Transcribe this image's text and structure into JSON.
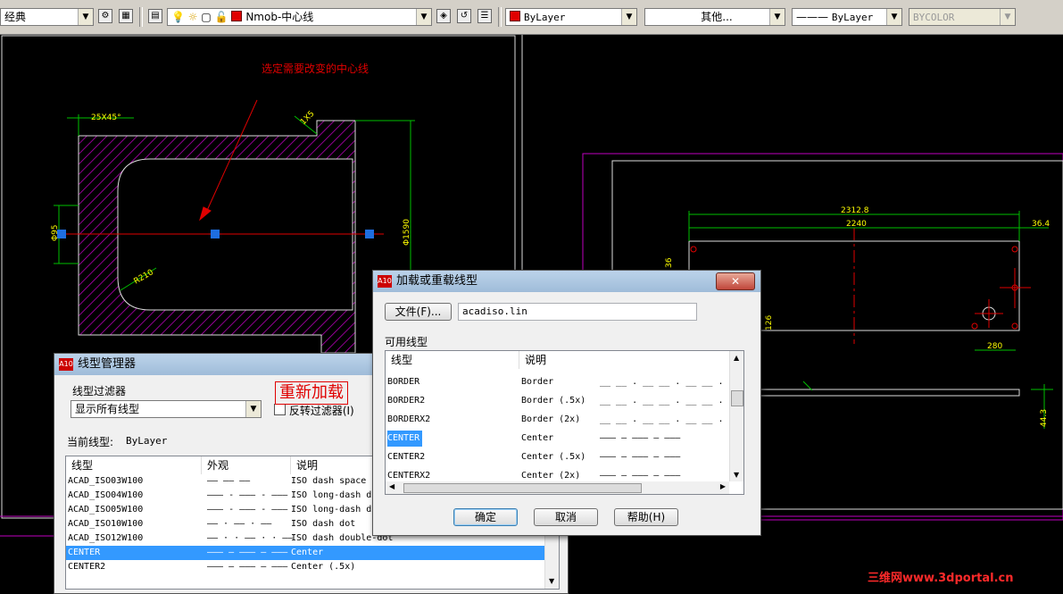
{
  "toolbar": {
    "workspace_combo": "经典",
    "layer_combo": "Nmob-中心线",
    "color_combo": "ByLayer",
    "linetype_combo": "其他...",
    "lineweight_combo": "ByLayer",
    "plotstyle_combo": "BYCOLOR"
  },
  "annotation": {
    "select_center_line": "选定需要改变的中心线",
    "reload": "重新加载"
  },
  "drawing": {
    "dims": [
      "25X45°",
      "Φ1590",
      "R210",
      "2312.8",
      "2240",
      "36.4",
      "280",
      "126",
      "44.3"
    ]
  },
  "watermark": "三维网www.3dportal.cn",
  "linetype_manager": {
    "title": "线型管理器",
    "filter_label": "线型过滤器",
    "filter_value": "显示所有线型",
    "invert_filter": "反转过滤器(I)",
    "current_label": "当前线型:",
    "current_value": "ByLayer",
    "col_linetype": "线型",
    "col_appearance": "外观",
    "col_description": "说明",
    "rows": [
      {
        "name": "ACAD_ISO03W100",
        "desc": "ISO dash space",
        "selected": false
      },
      {
        "name": "ACAD_ISO04W100",
        "desc": "ISO long-dash d",
        "selected": false
      },
      {
        "name": "ACAD_ISO05W100",
        "desc": "ISO long-dash d",
        "selected": false
      },
      {
        "name": "ACAD_ISO10W100",
        "desc": "ISO dash dot",
        "selected": false
      },
      {
        "name": "ACAD_ISO12W100",
        "desc": "ISO dash double-dot",
        "selected": false
      },
      {
        "name": "CENTER",
        "desc": "Center",
        "selected": true
      },
      {
        "name": "CENTER2",
        "desc": "Center (.5x)",
        "selected": false
      }
    ]
  },
  "load_dialog": {
    "title": "加载或重载线型",
    "file_button": "文件(F)...",
    "file_value": "acadiso.lin",
    "available_label": "可用线型",
    "col_linetype": "线型",
    "col_description": "说明",
    "rows": [
      {
        "name": "BORDER",
        "desc": "Border",
        "selected": false
      },
      {
        "name": "BORDER2",
        "desc": "Border (.5x)",
        "selected": false
      },
      {
        "name": "BORDERX2",
        "desc": "Border (2x)",
        "selected": false
      },
      {
        "name": "CENTER",
        "desc": "Center",
        "selected": true
      },
      {
        "name": "CENTER2",
        "desc": "Center (.5x)",
        "selected": false
      },
      {
        "name": "CENTERX2",
        "desc": "Center (2x)",
        "selected": false
      }
    ],
    "ok": "确定",
    "cancel": "取消",
    "help": "帮助(H)"
  }
}
